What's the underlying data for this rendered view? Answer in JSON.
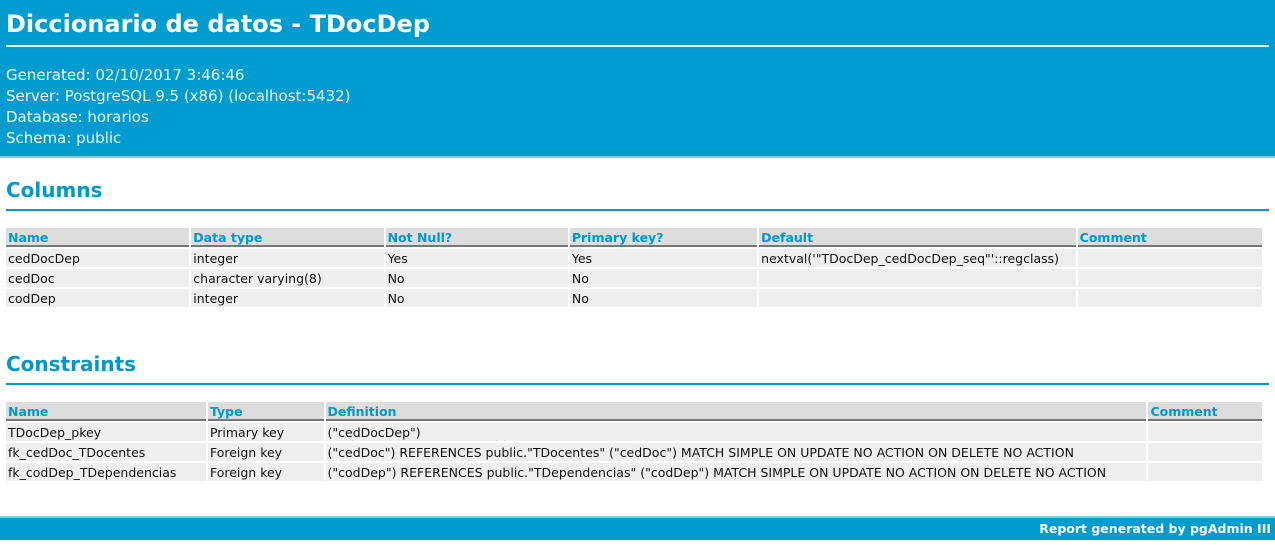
{
  "header": {
    "title": "Diccionario de datos - TDocDep",
    "generated_label": "Generated:",
    "generated_value": "02/10/2017 3:46:46",
    "server_label": "Server:",
    "server_value": "PostgreSQL 9.5 (x86) (localhost:5432)",
    "database_label": "Database:",
    "database_value": "horarios",
    "schema_label": "Schema:",
    "schema_value": "public"
  },
  "columns": {
    "heading": "Columns",
    "headers": [
      "Name",
      "Data type",
      "Not Null?",
      "Primary key?",
      "Default",
      "Comment"
    ],
    "rows": [
      [
        "cedDocDep",
        "integer",
        "Yes",
        "Yes",
        "nextval('\"TDocDep_cedDocDep_seq\"'::regclass)",
        ""
      ],
      [
        "cedDoc",
        "character varying(8)",
        "No",
        "No",
        "",
        ""
      ],
      [
        "codDep",
        "integer",
        "No",
        "No",
        "",
        ""
      ]
    ]
  },
  "constraints": {
    "heading": "Constraints",
    "headers": [
      "Name",
      "Type",
      "Definition",
      "Comment"
    ],
    "rows": [
      [
        "TDocDep_pkey",
        "Primary key",
        "(\"cedDocDep\")",
        ""
      ],
      [
        "fk_cedDoc_TDocentes",
        "Foreign key",
        "(\"cedDoc\") REFERENCES public.\"TDocentes\" (\"cedDoc\") MATCH SIMPLE ON UPDATE NO ACTION ON DELETE NO ACTION",
        ""
      ],
      [
        "fk_codDep_TDependencias",
        "Foreign key",
        "(\"codDep\") REFERENCES public.\"TDependencias\" (\"codDep\") MATCH SIMPLE ON UPDATE NO ACTION ON DELETE NO ACTION",
        ""
      ]
    ]
  },
  "footer": {
    "text": "Report generated by pgAdmin III"
  },
  "colors": {
    "header_bg": "#009cd0",
    "accent": "#0099cc",
    "table_header_bg": "#dddddd",
    "table_cell_bg": "#eeeeee"
  }
}
